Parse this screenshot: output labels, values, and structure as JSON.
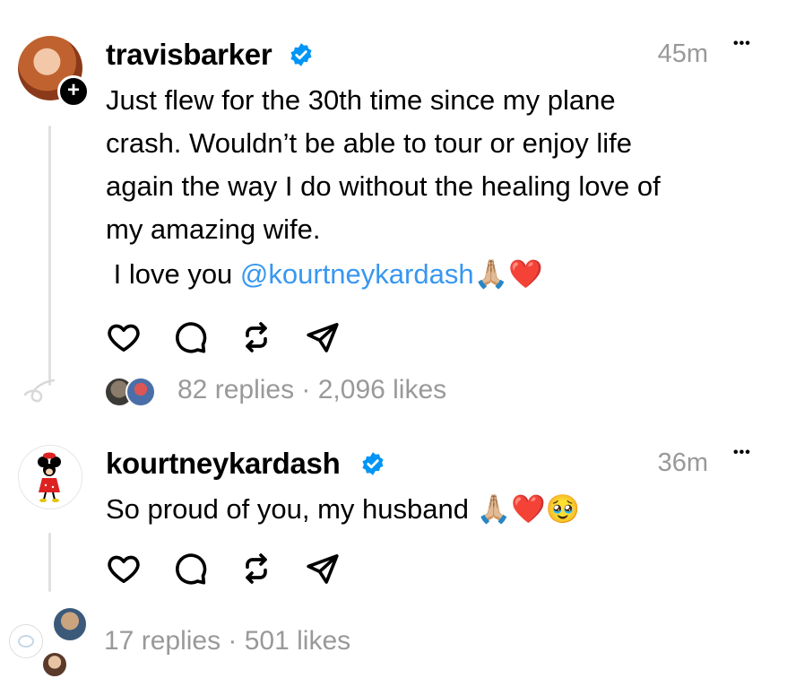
{
  "post1": {
    "username": "travisbarker",
    "time": "45m",
    "more": "•••",
    "text_lines": [
      "Just flew for the 30th time since my plane",
      "crash. Wouldn’t be able to tour or enjoy life",
      "again the way I do without the healing love of",
      "my amazing wife."
    ],
    "love_prefix": " I love you ",
    "mention": "@kourtneykardash",
    "emojis": "🙏🏼❤️",
    "stats": "82 replies · 2,096 likes",
    "follow_badge": "+"
  },
  "post2": {
    "username": "kourtneykardash",
    "time": "36m",
    "more": "•••",
    "text": "So proud of you, my husband ",
    "emojis": "🙏🏼❤️🥹",
    "stats": "17 replies · 501 likes"
  },
  "icons": {
    "like": "heart-icon",
    "reply": "comment-icon",
    "repost": "repost-icon",
    "share": "send-icon",
    "verified": "verified-badge-icon"
  },
  "colors": {
    "verified": "#0095f6",
    "mention": "#3897f0",
    "muted": "#999999",
    "thread_line": "#e0e0e0"
  }
}
